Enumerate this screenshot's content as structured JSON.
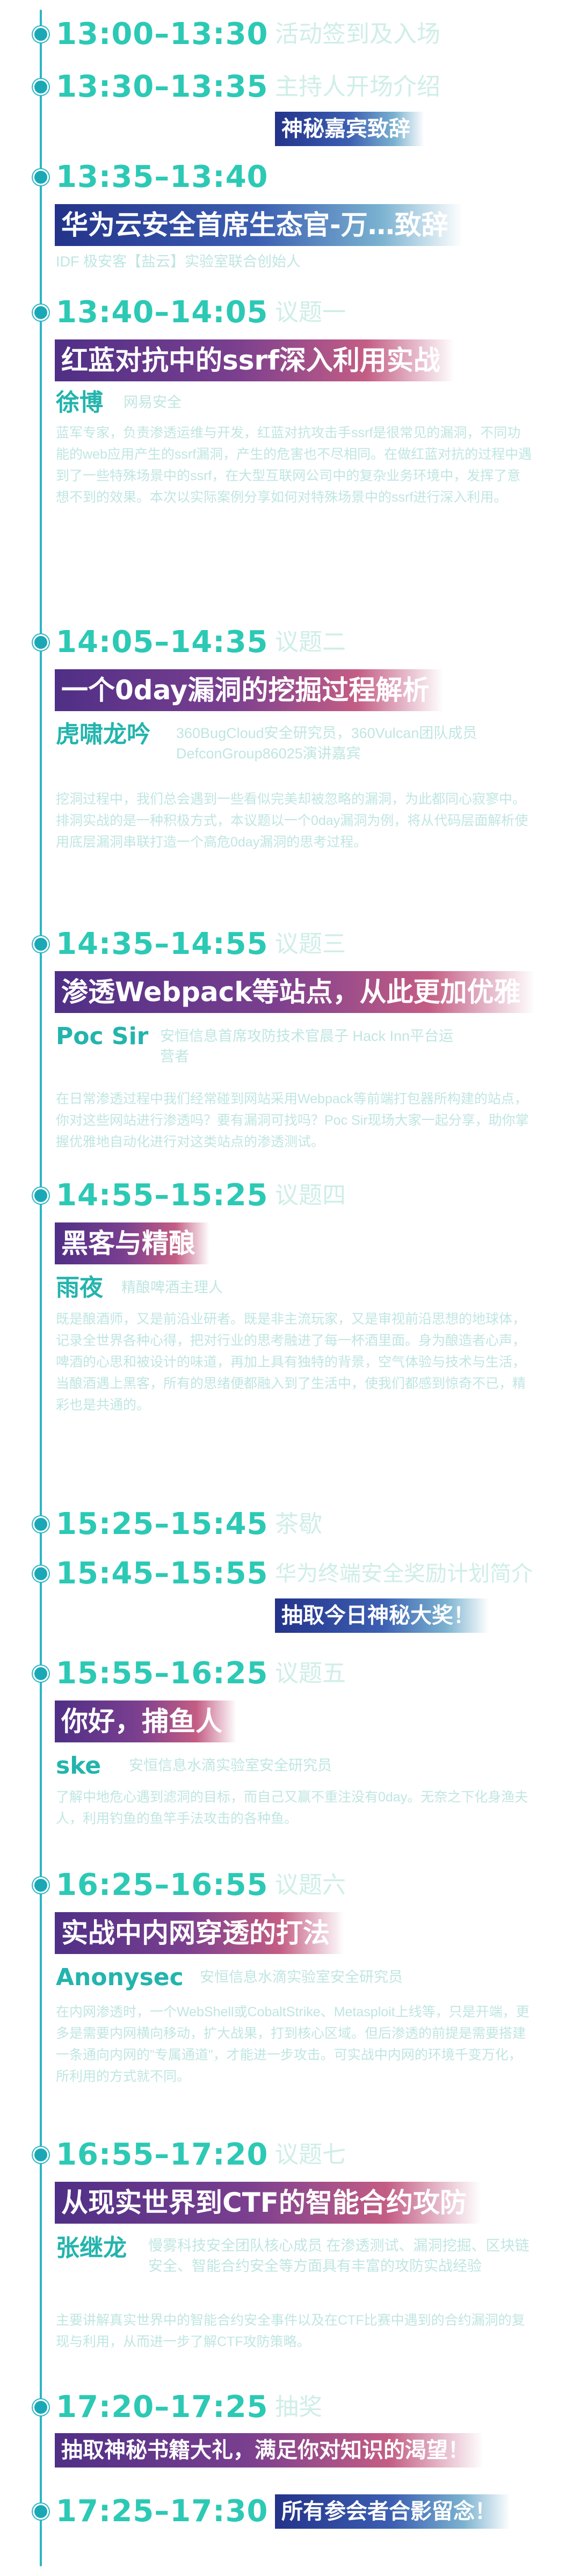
{
  "schedule": [
    {
      "time": "13:00–13:30",
      "label": "活动签到及入场"
    },
    {
      "time": "13:30–13:35",
      "label": "主持人开场介绍",
      "banner": "神秘嘉宾致辞"
    },
    {
      "time": "13:35–13:40",
      "banner": "华为云安全首席生态官-万…致辞",
      "speaker_title": "IDF 极安客【盐云】实验室联合创始人"
    },
    {
      "time": "13:40–14:05",
      "label": "议题一",
      "banner": "红蓝对抗中的ssrf深入利用实战",
      "speaker": "徐博",
      "speaker_title": "网易安全",
      "desc": "蓝军专家，负责渗透运维与开发，红蓝对抗攻击手ssrf是很常见的漏洞，不同功能的web应用产生的ssrf漏洞，产生的危害也不尽相同。在做红蓝对抗的过程中遇到了一些特殊场景中的ssrf，在大型互联网公司中的复杂业务环境中，发挥了意想不到的效果。本次以实际案例分享如何对特殊场景中的ssrf进行深入利用。"
    },
    {
      "time": "14:05–14:35",
      "label": "议题二",
      "banner": "一个0day漏洞的挖掘过程解析",
      "speaker": "虎啸龙吟",
      "speaker_title": "360BugCloud安全研究员，360Vulcan团队成员 DefconGroup86025演讲嘉宾",
      "desc": "挖洞过程中，我们总会遇到一些看似完美却被忽略的漏洞，为此都同心寂寥中。排洞实战的是一种积极方式，本议题以一个0day漏洞为例，将从代码层面解析使用底层漏洞串联打造一个高危0day漏洞的思考过程。"
    },
    {
      "time": "14:35–14:55",
      "label": "议题三",
      "banner": "渗透Webpack等站点，从此更加优雅",
      "speaker": "Poc Sir",
      "speaker_title": "安恒信息首席攻防技术官晨子 Hack Inn平台运营者",
      "desc": "在日常渗透过程中我们经常碰到网站采用Webpack等前端打包器所构建的站点，你对这些网站进行渗透吗？要有漏洞可找吗？Poc Sir现场大家一起分享，助你掌握优雅地自动化进行对这类站点的渗透测试。"
    },
    {
      "time": "14:55–15:25",
      "label": "议题四",
      "banner": "黑客与精酿",
      "speaker": "雨夜",
      "speaker_title": "精酿啤酒主理人",
      "desc": "既是酿酒师，又是前沿业研者。既是非主流玩家，又是审视前沿思想的地球体，记录全世界各种心得，把对行业的思考融进了每一杯酒里面。身为酿造者心声，啤酒的心思和被设计的味道，再加上具有独特的背景，空气体验与技术与生活，当酿酒遇上黑客，所有的思绪便都融入到了生活中，使我们都感到惊奇不已，精彩也是共通的。"
    },
    {
      "time": "15:25–15:45",
      "label": "茶歇"
    },
    {
      "time": "15:45–15:55",
      "label": "华为终端安全奖励计划简介",
      "banner": "抽取今日神秘大奖！"
    },
    {
      "time": "15:55–16:25",
      "label": "议题五",
      "banner": "你好，捕鱼人",
      "speaker": "ske",
      "speaker_title": "安恒信息水滴实验室安全研究员",
      "desc": "了解中地危心遇到滤洞的目标，而自己又赢不重注没有0day。无奈之下化身渔夫人，利用钓鱼的鱼竿手法攻击的各种鱼。"
    },
    {
      "time": "16:25–16:55",
      "label": "议题六",
      "banner": "实战中内网穿透的打法",
      "speaker": "Anonysec",
      "speaker_title": "安恒信息水滴实验室安全研究员",
      "desc": "在内网渗透时，一个WebShell或CobaltStrike、Metasploit上线等，只是开端，更多是需要内网横向移动，扩大战果，打到核心区域。但后渗透的前提是需要搭建一条通向内网的\"专属通道\"，才能进一步攻击。可实战中内网的环境千变万化，所利用的方式就不同。"
    },
    {
      "time": "16:55–17:20",
      "label": "议题七",
      "banner": "从现实世界到CTF的智能合约攻防",
      "speaker": "张继龙",
      "speaker_title": "慢雾科技安全团队核心成员 在渗透测试、漏洞挖掘、区块链安全、智能合约安全等方面具有丰富的攻防实战经验",
      "desc": "主要讲解真实世界中的智能合约安全事件以及在CTF比赛中遇到的合约漏洞的复现与利用，从而进一步了解CTF攻防策略。"
    },
    {
      "time": "17:20–17:25",
      "label": "抽奖",
      "banner": "抽取神秘书籍大礼，满足你对知识的渴望！"
    },
    {
      "time": "17:25–17:30",
      "banner": "所有参会者合影留念！"
    }
  ]
}
